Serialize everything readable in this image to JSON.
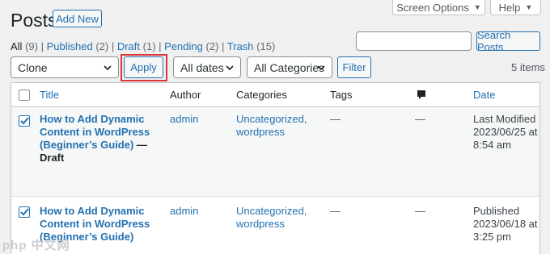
{
  "header": {
    "title": "Posts",
    "add_new_label": "Add New",
    "screen_options_label": "Screen Options",
    "help_label": "Help"
  },
  "subsubsub": [
    {
      "label": "All",
      "count": "(9)"
    },
    {
      "label": "Published",
      "count": "(2)"
    },
    {
      "label": "Draft",
      "count": "(1)"
    },
    {
      "label": "Pending",
      "count": "(2)"
    },
    {
      "label": "Trash",
      "count": "(15)"
    }
  ],
  "search": {
    "value": "",
    "placeholder": "",
    "button_label": "Search Posts"
  },
  "bulk": {
    "action_selected": "Clone",
    "apply_label": "Apply",
    "dates_selected": "All dates",
    "categories_selected": "All Categories",
    "filter_label": "Filter",
    "items_count": "5 items"
  },
  "table": {
    "columns": {
      "title": "Title",
      "author": "Author",
      "categories": "Categories",
      "tags": "Tags",
      "comments_icon": "comment-bubble-icon",
      "date": "Date"
    },
    "rows": [
      {
        "checked": true,
        "title_lines": [
          "How to Add Dynamic",
          "Content in WordPress",
          "(Beginner’s Guide)"
        ],
        "state_sep": " — ",
        "state": "Draft",
        "author": "admin",
        "category_1": "Uncategorized,",
        "category_2": "wordpress",
        "tags": "—",
        "comments": "—",
        "date_status": "Last Modified",
        "date_value": "2023/06/25 at",
        "date_time": "8:54 am"
      },
      {
        "checked": true,
        "title_lines": [
          "How to Add Dynamic",
          "Content in WordPress",
          "(Beginner’s Guide)"
        ],
        "state_sep": "",
        "state": "",
        "author": "admin",
        "category_1": "Uncategorized,",
        "category_2": "wordpress",
        "tags": "—",
        "comments": "—",
        "date_status": "Published",
        "date_value": "2023/06/18 at",
        "date_time": "3:25 pm"
      }
    ]
  },
  "watermark": "php 中文网",
  "colors": {
    "accent": "#2271b1",
    "highlight_border": "#d63638",
    "background": "#f0f0f1"
  }
}
